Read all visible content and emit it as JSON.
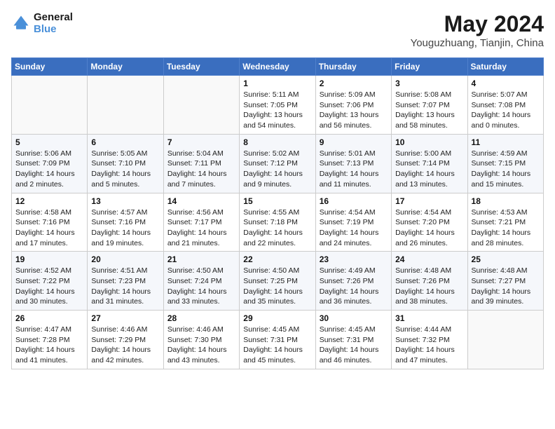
{
  "header": {
    "logo_line1": "General",
    "logo_line2": "Blue",
    "month_title": "May 2024",
    "location": "Youguzhuang, Tianjin, China"
  },
  "days_of_week": [
    "Sunday",
    "Monday",
    "Tuesday",
    "Wednesday",
    "Thursday",
    "Friday",
    "Saturday"
  ],
  "weeks": [
    [
      {
        "day": "",
        "info": ""
      },
      {
        "day": "",
        "info": ""
      },
      {
        "day": "",
        "info": ""
      },
      {
        "day": "1",
        "info": "Sunrise: 5:11 AM\nSunset: 7:05 PM\nDaylight: 13 hours\nand 54 minutes."
      },
      {
        "day": "2",
        "info": "Sunrise: 5:09 AM\nSunset: 7:06 PM\nDaylight: 13 hours\nand 56 minutes."
      },
      {
        "day": "3",
        "info": "Sunrise: 5:08 AM\nSunset: 7:07 PM\nDaylight: 13 hours\nand 58 minutes."
      },
      {
        "day": "4",
        "info": "Sunrise: 5:07 AM\nSunset: 7:08 PM\nDaylight: 14 hours\nand 0 minutes."
      }
    ],
    [
      {
        "day": "5",
        "info": "Sunrise: 5:06 AM\nSunset: 7:09 PM\nDaylight: 14 hours\nand 2 minutes."
      },
      {
        "day": "6",
        "info": "Sunrise: 5:05 AM\nSunset: 7:10 PM\nDaylight: 14 hours\nand 5 minutes."
      },
      {
        "day": "7",
        "info": "Sunrise: 5:04 AM\nSunset: 7:11 PM\nDaylight: 14 hours\nand 7 minutes."
      },
      {
        "day": "8",
        "info": "Sunrise: 5:02 AM\nSunset: 7:12 PM\nDaylight: 14 hours\nand 9 minutes."
      },
      {
        "day": "9",
        "info": "Sunrise: 5:01 AM\nSunset: 7:13 PM\nDaylight: 14 hours\nand 11 minutes."
      },
      {
        "day": "10",
        "info": "Sunrise: 5:00 AM\nSunset: 7:14 PM\nDaylight: 14 hours\nand 13 minutes."
      },
      {
        "day": "11",
        "info": "Sunrise: 4:59 AM\nSunset: 7:15 PM\nDaylight: 14 hours\nand 15 minutes."
      }
    ],
    [
      {
        "day": "12",
        "info": "Sunrise: 4:58 AM\nSunset: 7:16 PM\nDaylight: 14 hours\nand 17 minutes."
      },
      {
        "day": "13",
        "info": "Sunrise: 4:57 AM\nSunset: 7:16 PM\nDaylight: 14 hours\nand 19 minutes."
      },
      {
        "day": "14",
        "info": "Sunrise: 4:56 AM\nSunset: 7:17 PM\nDaylight: 14 hours\nand 21 minutes."
      },
      {
        "day": "15",
        "info": "Sunrise: 4:55 AM\nSunset: 7:18 PM\nDaylight: 14 hours\nand 22 minutes."
      },
      {
        "day": "16",
        "info": "Sunrise: 4:54 AM\nSunset: 7:19 PM\nDaylight: 14 hours\nand 24 minutes."
      },
      {
        "day": "17",
        "info": "Sunrise: 4:54 AM\nSunset: 7:20 PM\nDaylight: 14 hours\nand 26 minutes."
      },
      {
        "day": "18",
        "info": "Sunrise: 4:53 AM\nSunset: 7:21 PM\nDaylight: 14 hours\nand 28 minutes."
      }
    ],
    [
      {
        "day": "19",
        "info": "Sunrise: 4:52 AM\nSunset: 7:22 PM\nDaylight: 14 hours\nand 30 minutes."
      },
      {
        "day": "20",
        "info": "Sunrise: 4:51 AM\nSunset: 7:23 PM\nDaylight: 14 hours\nand 31 minutes."
      },
      {
        "day": "21",
        "info": "Sunrise: 4:50 AM\nSunset: 7:24 PM\nDaylight: 14 hours\nand 33 minutes."
      },
      {
        "day": "22",
        "info": "Sunrise: 4:50 AM\nSunset: 7:25 PM\nDaylight: 14 hours\nand 35 minutes."
      },
      {
        "day": "23",
        "info": "Sunrise: 4:49 AM\nSunset: 7:26 PM\nDaylight: 14 hours\nand 36 minutes."
      },
      {
        "day": "24",
        "info": "Sunrise: 4:48 AM\nSunset: 7:26 PM\nDaylight: 14 hours\nand 38 minutes."
      },
      {
        "day": "25",
        "info": "Sunrise: 4:48 AM\nSunset: 7:27 PM\nDaylight: 14 hours\nand 39 minutes."
      }
    ],
    [
      {
        "day": "26",
        "info": "Sunrise: 4:47 AM\nSunset: 7:28 PM\nDaylight: 14 hours\nand 41 minutes."
      },
      {
        "day": "27",
        "info": "Sunrise: 4:46 AM\nSunset: 7:29 PM\nDaylight: 14 hours\nand 42 minutes."
      },
      {
        "day": "28",
        "info": "Sunrise: 4:46 AM\nSunset: 7:30 PM\nDaylight: 14 hours\nand 43 minutes."
      },
      {
        "day": "29",
        "info": "Sunrise: 4:45 AM\nSunset: 7:31 PM\nDaylight: 14 hours\nand 45 minutes."
      },
      {
        "day": "30",
        "info": "Sunrise: 4:45 AM\nSunset: 7:31 PM\nDaylight: 14 hours\nand 46 minutes."
      },
      {
        "day": "31",
        "info": "Sunrise: 4:44 AM\nSunset: 7:32 PM\nDaylight: 14 hours\nand 47 minutes."
      },
      {
        "day": "",
        "info": ""
      }
    ]
  ]
}
